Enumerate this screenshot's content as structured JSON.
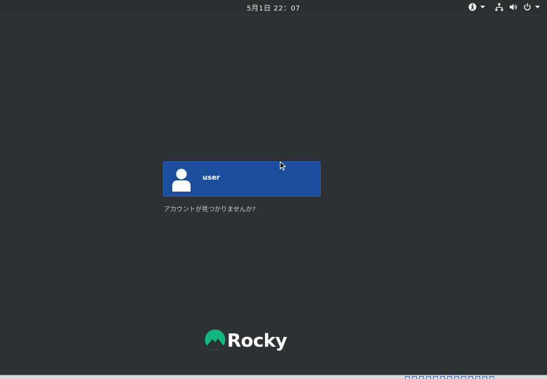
{
  "topbar": {
    "clock": "5月1日 22：07",
    "icons": [
      "accessibility-icon",
      "network-icon",
      "volume-icon",
      "power-icon"
    ]
  },
  "login": {
    "username": "user",
    "not_listed": "アカウントが見つかりませんか?"
  },
  "branding": {
    "logo_text": "Rocky",
    "logo_color": "#10b981"
  },
  "colors": {
    "background": "#2c3133",
    "card": "#1b4f9e"
  }
}
